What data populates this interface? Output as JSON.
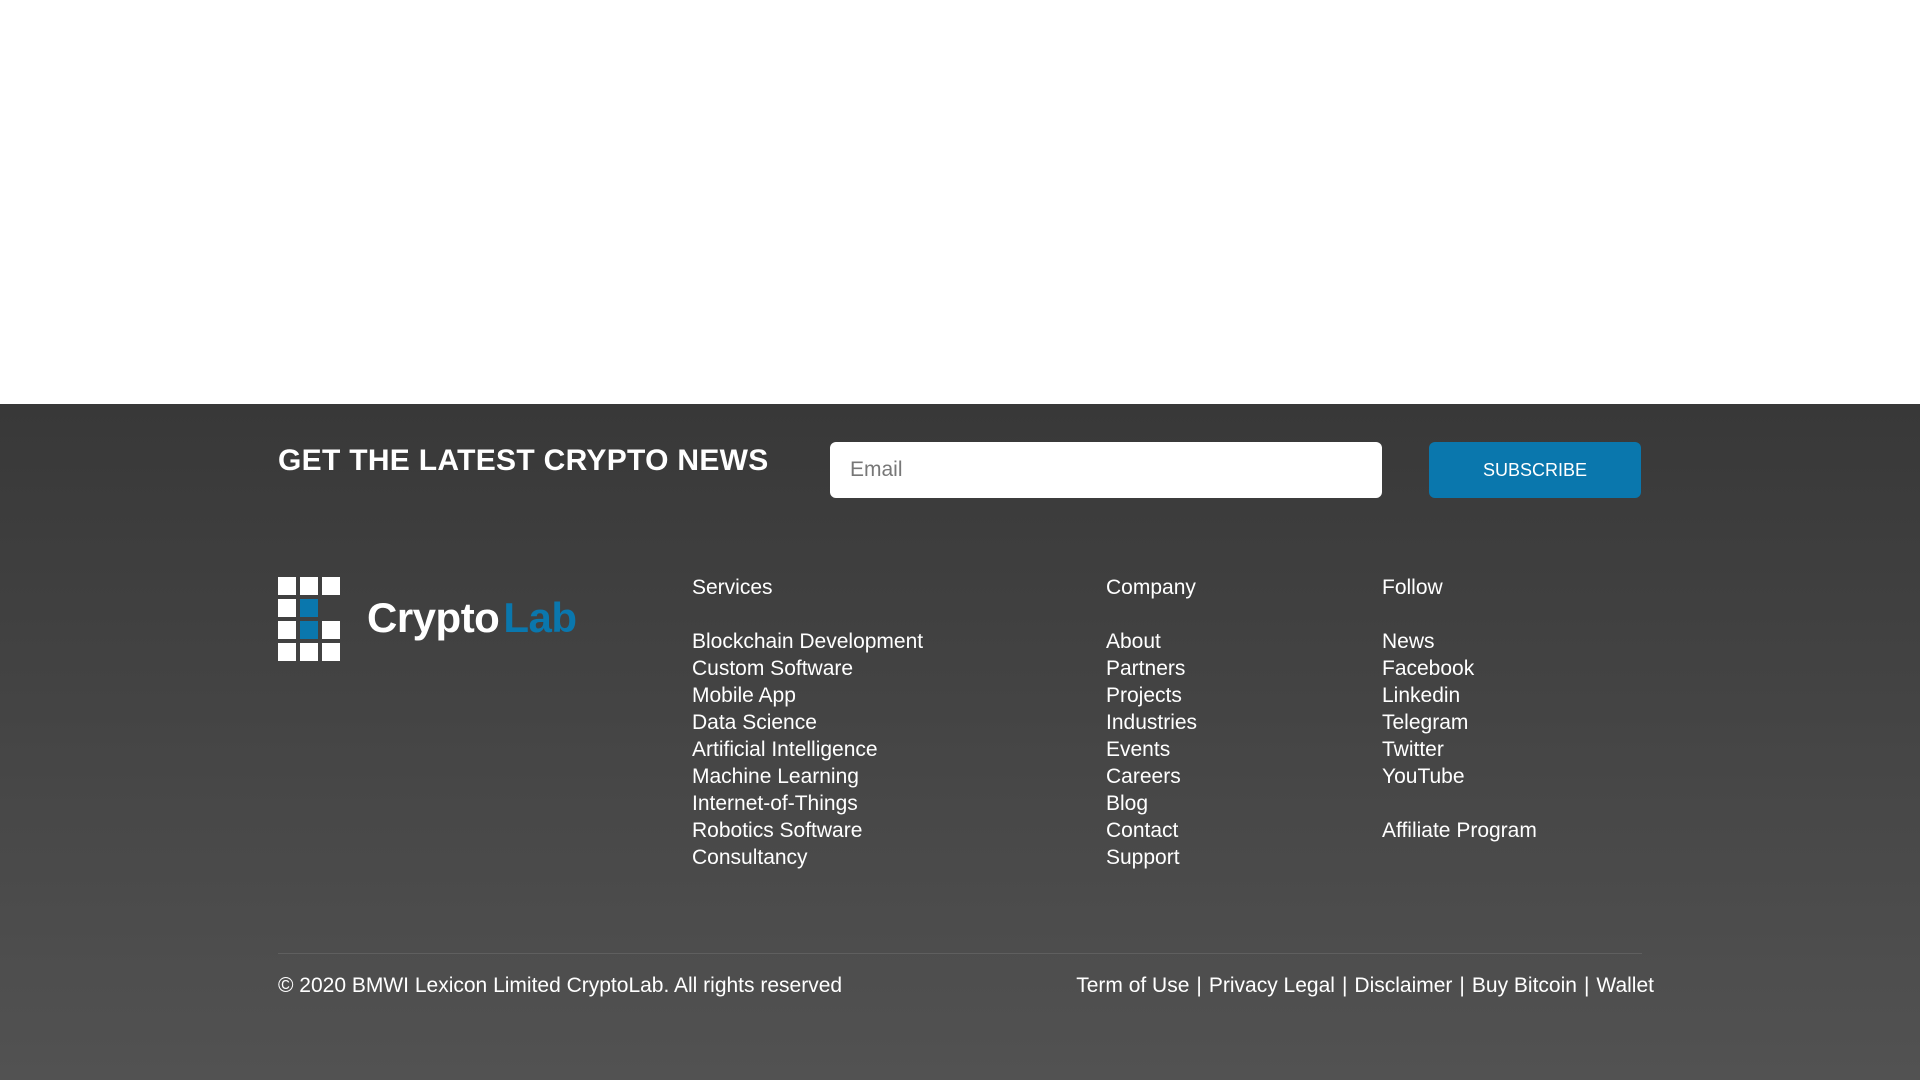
{
  "newsletter": {
    "heading": "GET THE LATEST CRYPTO NEWS",
    "email_placeholder": "Email",
    "subscribe_label": "SUBSCRIBE"
  },
  "logo": {
    "text_primary": "Crypto",
    "text_accent": "Lab",
    "icon": "grid-logo-icon"
  },
  "columns": {
    "services": {
      "heading": "Services",
      "items": [
        "Blockchain Development",
        "Custom Software",
        "Mobile App",
        "Data Science",
        "Artificial Intelligence",
        "Machine Learning",
        "Internet-of-Things",
        "Robotics Software",
        "Consultancy"
      ]
    },
    "company": {
      "heading": "Company",
      "items": [
        "About",
        "Partners",
        "Projects",
        "Industries",
        "Events",
        "Careers",
        "Blog",
        "Contact",
        "Support"
      ]
    },
    "follow": {
      "heading": "Follow",
      "items": [
        "News",
        "Facebook",
        "Linkedin",
        "Telegram",
        "Twitter",
        "YouTube"
      ],
      "extra": "Affiliate Program"
    }
  },
  "bottom": {
    "copyright": "© 2020 BMWI Lexicon Limited CryptoLab. All rights reserved",
    "separator": "|",
    "links": [
      "Term of Use",
      "Privacy Legal",
      "Disclaimer",
      "Buy Bitcoin",
      "Wallet"
    ]
  },
  "colors": {
    "accent": "#0a77ad",
    "footer_background": "#444444",
    "text": "#ffffff"
  }
}
